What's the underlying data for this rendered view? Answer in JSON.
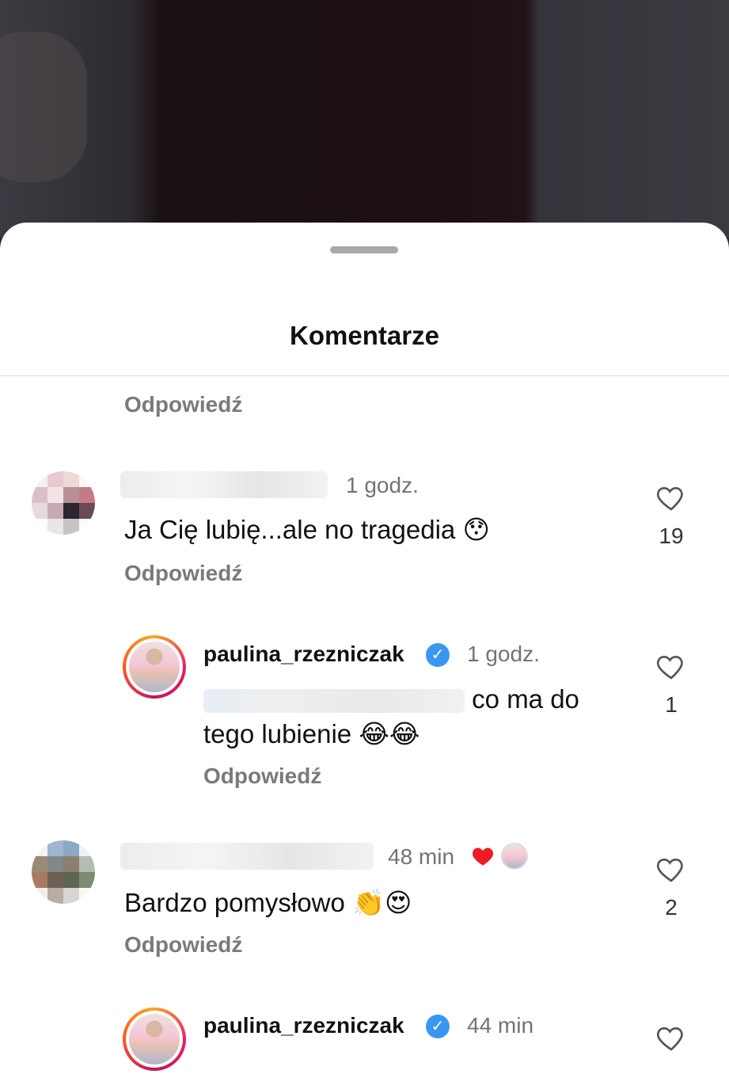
{
  "header": {
    "title": "Komentarze"
  },
  "reply_label": "Odpowiedź",
  "colors": {
    "accent_red": "#ed4956",
    "verified_blue": "#3897f0",
    "muted": "#737373"
  },
  "comments": [
    {
      "username": "",
      "time": "1 godz.",
      "text": "Ja Cię lubię...ale no tragedia",
      "emoji": "😯",
      "likes": "19"
    },
    {
      "username": "paulina_rzezniczak",
      "verified": true,
      "time": "1 godz.",
      "text_after_mention": "co ma do",
      "text_line2": "tego lubienie",
      "emoji": "😂😂",
      "likes": "1"
    },
    {
      "username": "",
      "time": "48 min",
      "author_liked": true,
      "text": "Bardzo pomysłowo",
      "emoji": "👏😍",
      "likes": "2"
    },
    {
      "username": "paulina_rzezniczak",
      "verified": true,
      "time": "44 min"
    }
  ]
}
